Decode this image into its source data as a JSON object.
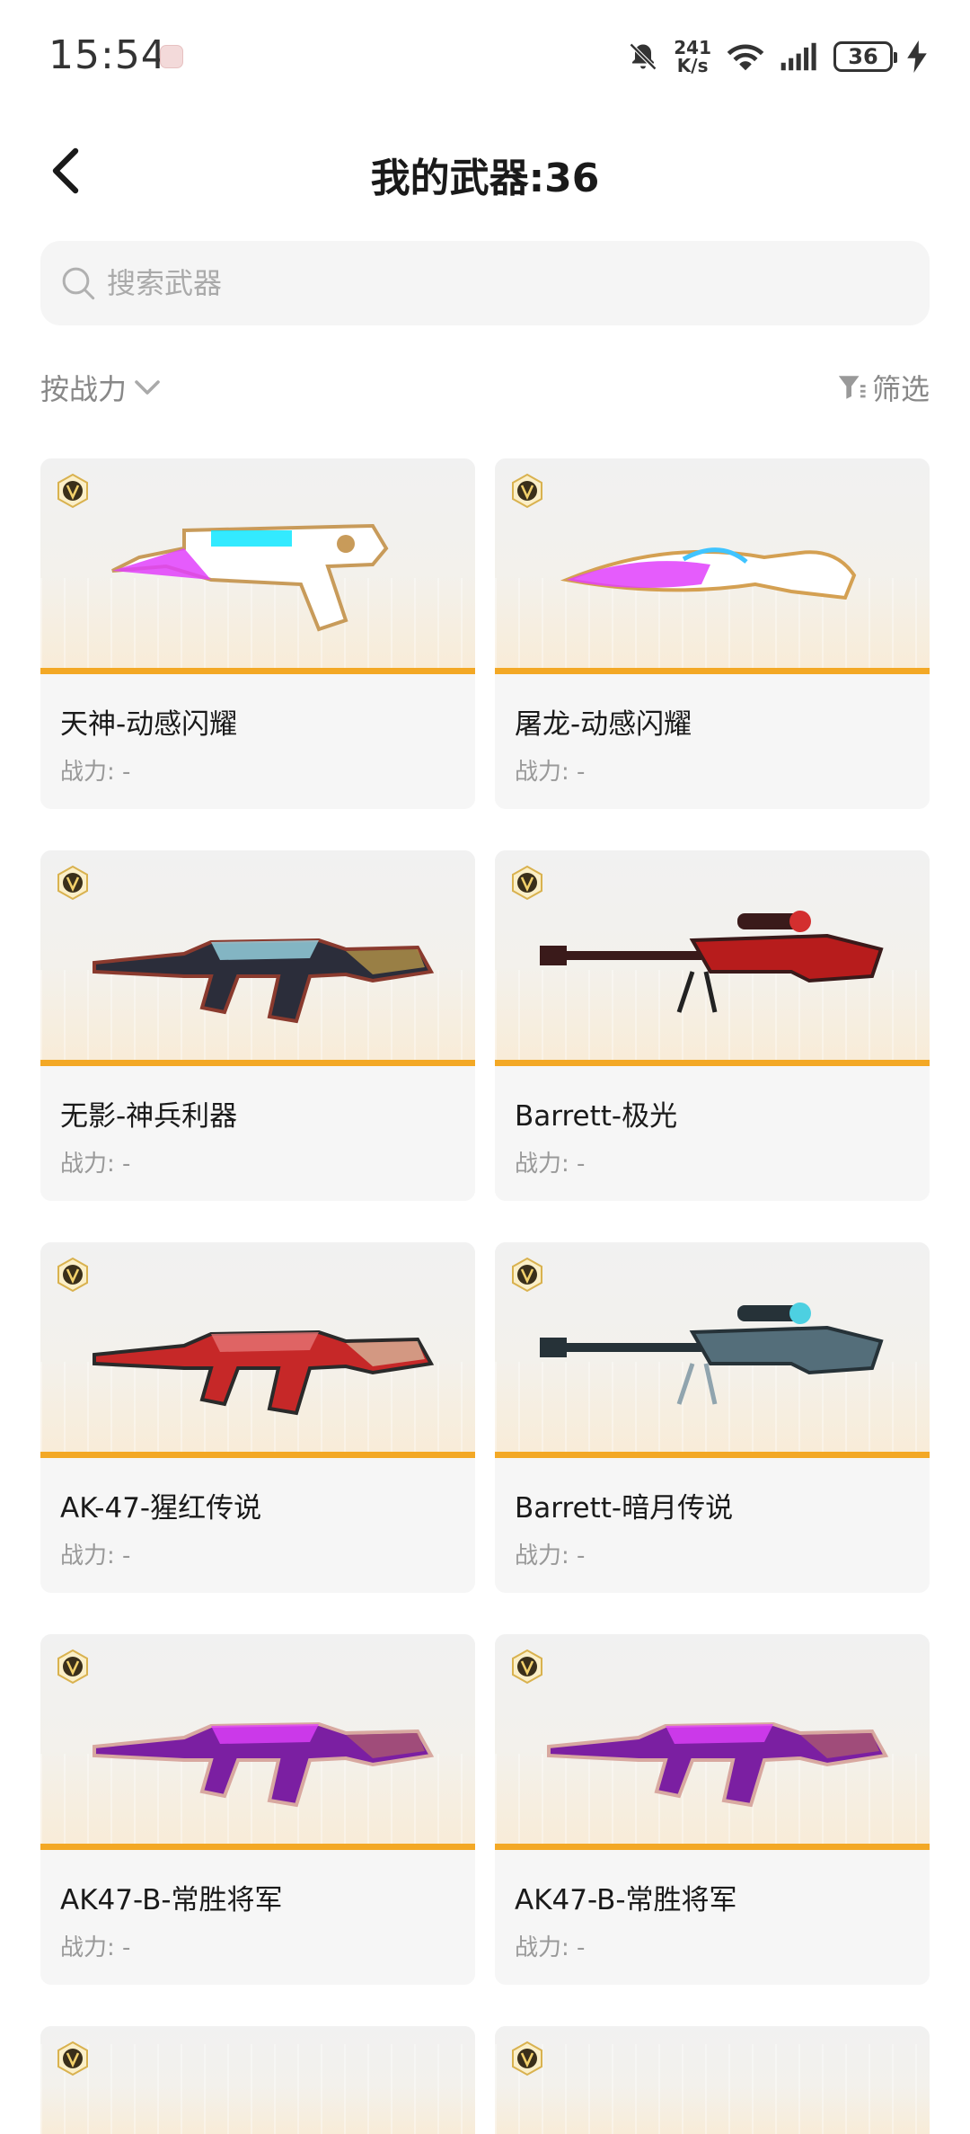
{
  "status": {
    "time": "15:54",
    "speed_value": "241",
    "speed_unit": "K/s",
    "battery": "36",
    "colors": {
      "text": "#333333"
    }
  },
  "header": {
    "title": "我的武器:36",
    "back_icon": "chevron-left-icon"
  },
  "search": {
    "placeholder": "搜索武器",
    "value": ""
  },
  "sort": {
    "label": "按战力",
    "filter_label": "筛选"
  },
  "accent": "#f3a825",
  "weapons": [
    {
      "name": "天神-动感闪耀",
      "power": "战力: -",
      "art": "pistol",
      "palette": [
        "#ffffff",
        "#c89b5a",
        "#e040fb",
        "#00e5ff"
      ]
    },
    {
      "name": "屠龙-动感闪耀",
      "power": "战力: -",
      "art": "knife",
      "palette": [
        "#ffffff",
        "#d4a052",
        "#e040fb",
        "#40c4ff"
      ]
    },
    {
      "name": "无影-神兵利器",
      "power": "战力: -",
      "art": "rifle",
      "palette": [
        "#2b2d3a",
        "#8a3a2e",
        "#9ad7e6",
        "#c9a24a"
      ]
    },
    {
      "name": "Barrett-极光",
      "power": "战力: -",
      "art": "sniper",
      "palette": [
        "#b71c1c",
        "#3a1a1a",
        "#d32f2f",
        "#222222"
      ]
    },
    {
      "name": "AK-47-猩红传说",
      "power": "战力: -",
      "art": "rifle",
      "palette": [
        "#c62828",
        "#2a2a2a",
        "#e57373",
        "#d8c8a8"
      ]
    },
    {
      "name": "Barrett-暗月传说",
      "power": "战力: -",
      "art": "sniper",
      "palette": [
        "#546e7a",
        "#263238",
        "#4dd0e1",
        "#90a4ae"
      ]
    },
    {
      "name": "AK47-B-常胜将军",
      "power": "战力: -",
      "art": "rifle",
      "palette": [
        "#7b1fa2",
        "#d8a8a0",
        "#e040fb",
        "#b0606a"
      ]
    },
    {
      "name": "AK47-B-常胜将军",
      "power": "战力: -",
      "art": "rifle",
      "palette": [
        "#7b1fa2",
        "#d8a8a0",
        "#e040fb",
        "#b0606a"
      ]
    }
  ]
}
